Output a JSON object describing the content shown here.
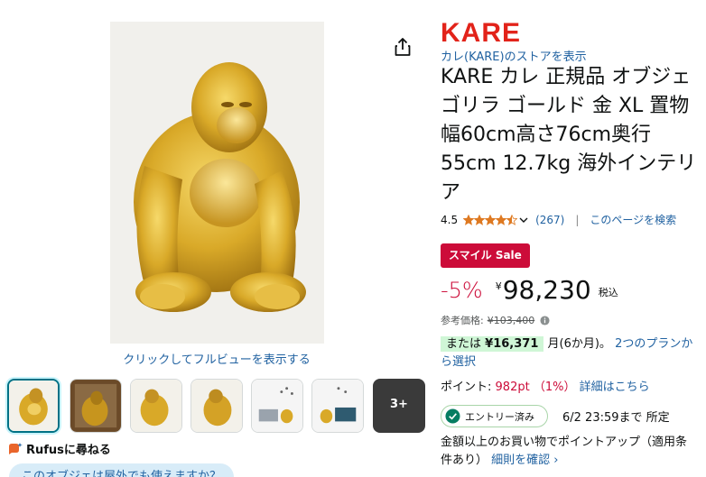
{
  "gallery": {
    "main_image_alt": "gold gorilla statue",
    "fullview_label": "クリックしてフルビューを表示する",
    "thumbnails": [
      {
        "name": "thumb-gorilla-front",
        "selected": true
      },
      {
        "name": "thumb-gorilla-room",
        "selected": false
      },
      {
        "name": "thumb-gorilla-side",
        "selected": false
      },
      {
        "name": "thumb-gorilla-back",
        "selected": false
      },
      {
        "name": "thumb-interior-1",
        "selected": false
      },
      {
        "name": "thumb-interior-2",
        "selected": false
      }
    ],
    "more_label": "3+"
  },
  "rufus": {
    "label": "Rufusに尋ねる",
    "suggestion": "このオブジェは屋外でも使えますか？"
  },
  "product": {
    "brand": "KARE",
    "store_link": "カレ(KARE)のストアを表示",
    "title": "KARE カレ 正規品 オブジェ ゴリラ ゴールド 金 XL 置物 幅60cm高さ76cm奥行55cm 12.7kg 海外インテリア",
    "rating": "4.5",
    "rating_value": 4.5,
    "review_count": "(267)",
    "search_page": "このページを検索",
    "sale_badge": "スマイル Sale",
    "discount": "-5%",
    "currency": "¥",
    "price": "98,230",
    "tax_label": "税込",
    "ref_label": "参考価格:",
    "ref_price": "¥103,400",
    "installment_prefix": "または",
    "installment_amount": "¥16,371",
    "installment_suffix": "月(6か月)。",
    "installment_link": "2つのプランから選択",
    "points_label": "ポイント:",
    "points_value": "982pt （1%）",
    "points_link": "詳細はこちら",
    "entry_badge": "エントリー済み",
    "entry_deadline": "6/2 23:59まで 所定",
    "points_up_text": "金額以上のお買い物でポイントアップ（適用条件あり）",
    "points_up_link": "細則を確認 ›"
  },
  "colors": {
    "brand_red": "#e2231a",
    "sale_red": "#cc0c39",
    "link_blue": "#2162a1",
    "star_orange": "#de7921",
    "installment_green": "#cff6d6",
    "check_green": "#067d62"
  },
  "icons": [
    "share-icon",
    "star-icon",
    "chevron-down-icon",
    "info-icon",
    "check-circle-icon",
    "rufus-icon"
  ]
}
